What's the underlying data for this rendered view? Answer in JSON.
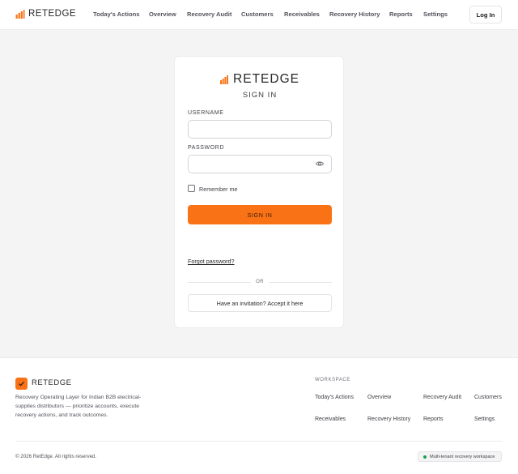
{
  "header": {
    "brand": "RETEDGE",
    "nav": [
      {
        "label": "Today's Actions"
      },
      {
        "label": "Overview"
      },
      {
        "label": "Recovery Audit"
      },
      {
        "label": "Customers"
      },
      {
        "label": "Receivables"
      },
      {
        "label": "Recovery History"
      },
      {
        "label": "Reports"
      },
      {
        "label": "Settings"
      }
    ],
    "login_label": "Log In"
  },
  "login_card": {
    "brand": "RETEDGE",
    "title": "SIGN IN",
    "username_label": "USERNAME",
    "username_value": "",
    "password_label": "PASSWORD",
    "password_value": "",
    "remember_label": "Remember me",
    "remember_checked": false,
    "signin_label": "SIGN IN",
    "forgot_label": "Forgot password?",
    "or_label": "OR",
    "invite_label": "Have an invitation? Accept it here"
  },
  "footer": {
    "brand": "RETEDGE",
    "description": "Recovery Operating Layer for Indian B2B electrical-supplies distributors — prioritize accounts, execute recovery actions, and track outcomes.",
    "workspace_heading": "WORKSPACE",
    "links": [
      {
        "label": "Today's Actions"
      },
      {
        "label": "Overview"
      },
      {
        "label": "Recovery Audit"
      },
      {
        "label": "Customers"
      },
      {
        "label": "Receivables"
      },
      {
        "label": "Recovery History"
      },
      {
        "label": "Reports"
      },
      {
        "label": "Settings"
      }
    ],
    "copyright": "© 2026 RetEdge. All rights reserved.",
    "badge": "Multi-tenant recovery workspace"
  },
  "icons": {
    "brand_mark": "bar-chart-icon",
    "password_toggle": "eye-icon",
    "footer_logo": "check-icon"
  },
  "colors": {
    "accent": "#f97316",
    "status_dot": "#16a34a"
  }
}
